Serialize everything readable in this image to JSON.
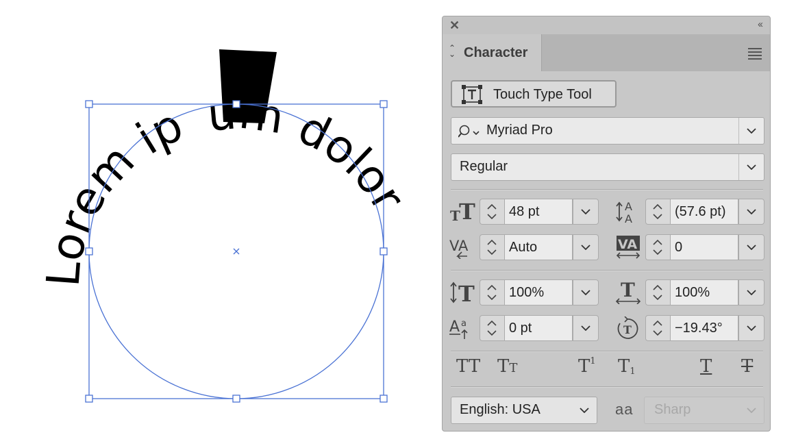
{
  "canvas": {
    "path_text": "Lorem ipsum dolor",
    "highlighted_char": "s"
  },
  "panel": {
    "title": "Character",
    "touch_type_label": "Touch Type Tool",
    "font_family": "Myriad Pro",
    "font_style": "Regular",
    "font_size": "48 pt",
    "leading": "(57.6 pt)",
    "kerning": "Auto",
    "tracking": "0",
    "vertical_scale": "100%",
    "horizontal_scale": "100%",
    "baseline_shift": "0 pt",
    "character_rotation": "−19.43°",
    "language": "English: USA",
    "anti_aliasing": "Sharp",
    "aa_icon_text": "aa",
    "accent_color": "#4a72d4"
  }
}
